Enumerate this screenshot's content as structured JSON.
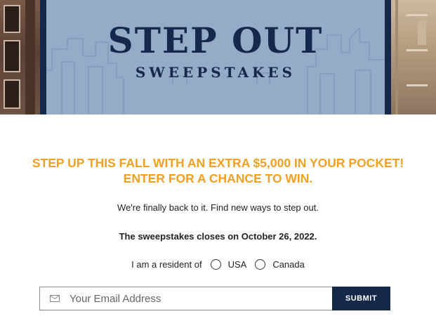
{
  "banner": {
    "title": "STEP OUT",
    "subtitle": "SWEEPSTAKES",
    "colors": {
      "panel": "#94acc6",
      "navy": "#14284a"
    }
  },
  "headline": {
    "line1": "STEP UP THIS FALL WITH AN EXTRA $5,000 IN YOUR POCKET!",
    "line2": "ENTER FOR A CHANCE TO WIN.",
    "color": "#f0a123"
  },
  "tagline": "We're finally back to it. Find new ways to step out.",
  "closing_notice": "The sweepstakes closes on October 26, 2022.",
  "residency": {
    "label": "I am a resident of",
    "options": [
      {
        "label": "USA",
        "selected": false
      },
      {
        "label": "Canada",
        "selected": false
      }
    ]
  },
  "email_form": {
    "icon": "envelope-icon",
    "placeholder": "Your Email Address",
    "value": "",
    "submit_label": "SUBMIT"
  }
}
